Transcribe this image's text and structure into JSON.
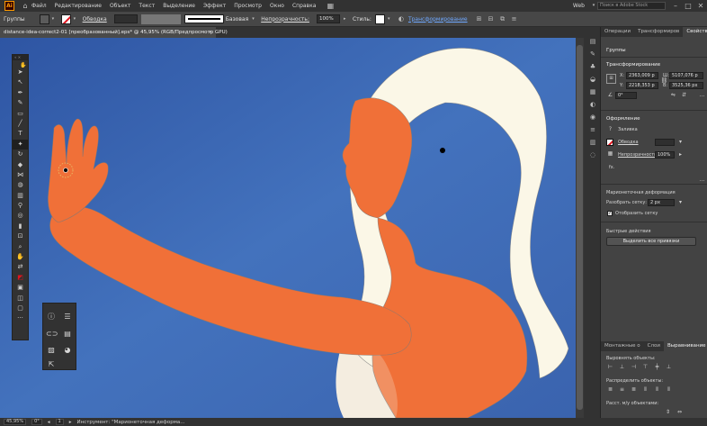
{
  "app": {
    "logo": "Ai"
  },
  "menu": [
    "Файл",
    "Редактирование",
    "Объект",
    "Текст",
    "Выделение",
    "Эффект",
    "Просмотр",
    "Окно",
    "Справка"
  ],
  "menubar_right": {
    "workspace": "Web",
    "search_placeholder": "Поиск в Adobe Stock"
  },
  "control_bar": {
    "selection_label": "Группы",
    "stroke_label": "Обводка",
    "stroke_style": "Базовая",
    "opacity_label": "Непрозрачность:",
    "opacity_value": "100%",
    "styles_label": "Стиль:",
    "transform_link": "Трансформирование"
  },
  "document": {
    "tab_title": "distance-idea-correct2-01 [преобразованный].eps* @ 45,95% (RGB/Предпросмотр GPU)",
    "close": "×"
  },
  "canvas": {
    "background": "#3e67b0",
    "skin_color": "#f07038",
    "hair_color": "#fbf7e7"
  },
  "status_bar": {
    "zoom": "45,95%",
    "angle": "0°",
    "page": "1",
    "tool_text": "Инструмент: \"Марионеточная деформа..."
  },
  "panel": {
    "tabs": [
      "Операции",
      "Трансформиров",
      "Свойства"
    ],
    "active_tab": "Свойства",
    "group_title": "Группы",
    "transform_title": "Трансформирование",
    "x_label": "X:",
    "x_value": "2363,009 р",
    "y_label": "Y:",
    "y_value": "2218,353 р",
    "w_label": "Ш:",
    "w_value": "5107,076 р",
    "h_label": "В:",
    "h_value": "3525,36 рх",
    "angle_value": "0°",
    "appearance_title": "Оформление",
    "fill_label": "Заливка",
    "stroke_label": "Обводка",
    "opacity_label": "Непрозрачность",
    "opacity_value": "100%",
    "fx_label": "fx.",
    "puppet_title": "Марионеточная деформация",
    "expand_label": "Разобрать сетку:",
    "expand_value": "2 px",
    "show_mesh_label": "Отобразить сетку",
    "quick_title": "Быстрые действия",
    "select_pins_button": "Выделить все привязки",
    "bottom_tabs": [
      "Монтажные о",
      "Слои",
      "Выравнивание"
    ],
    "align_objects": "Выровнять объекты:",
    "distribute_objects": "Распределить объекты:",
    "distribute_spacing": "Расст. м/у объектами:"
  }
}
